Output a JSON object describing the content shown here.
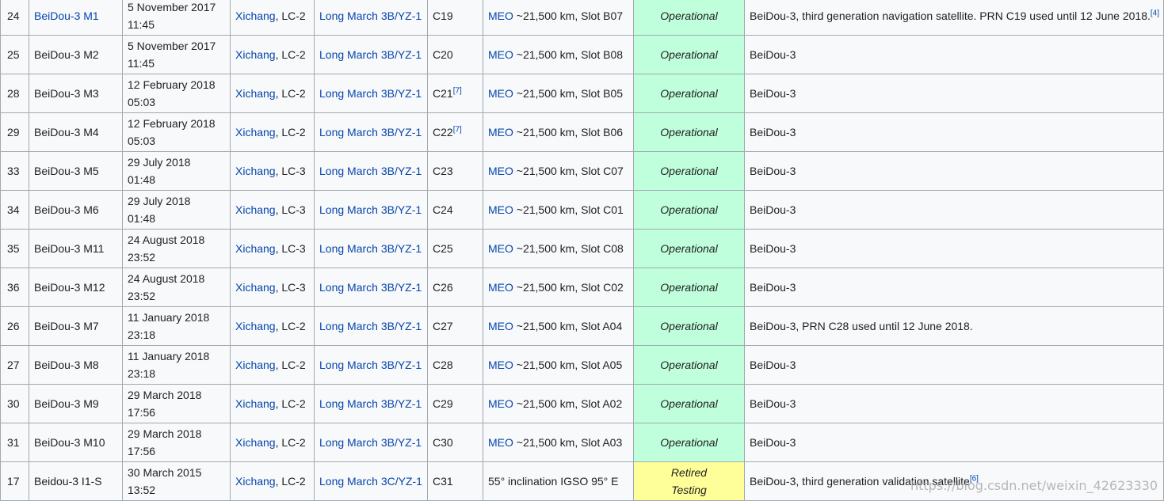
{
  "rows": [
    {
      "n": "24",
      "name": "BeiDou-3 M1",
      "name_link": true,
      "date1": "5 November 2017",
      "date2": "11:45",
      "site_link": "Xichang",
      "site_rest": ", LC-2",
      "rocket": "Long March 3B/YZ-1",
      "prn": "C19",
      "prn_sup": "",
      "orbit_link": "MEO",
      "orbit_rest": " ~21,500 km, Slot B07",
      "status": "Operational",
      "status_type": "op",
      "status2": "",
      "remarks": "BeiDou-3, third generation navigation satellite. PRN C19 used until 12 June 2018.",
      "remarks_sup": "[4]"
    },
    {
      "n": "25",
      "name": "BeiDou-3 M2",
      "name_link": false,
      "date1": "5 November 2017",
      "date2": "11:45",
      "site_link": "Xichang",
      "site_rest": ", LC-2",
      "rocket": "Long March 3B/YZ-1",
      "prn": "C20",
      "prn_sup": "",
      "orbit_link": "MEO",
      "orbit_rest": " ~21,500 km, Slot B08",
      "status": "Operational",
      "status_type": "op",
      "status2": "",
      "remarks": "BeiDou-3",
      "remarks_sup": ""
    },
    {
      "n": "28",
      "name": "BeiDou-3 M3",
      "name_link": false,
      "date1": "12 February 2018",
      "date2": "05:03",
      "site_link": "Xichang",
      "site_rest": ", LC-2",
      "rocket": "Long March 3B/YZ-1",
      "prn": "C21",
      "prn_sup": "[7]",
      "orbit_link": "MEO",
      "orbit_rest": " ~21,500 km, Slot B05",
      "status": "Operational",
      "status_type": "op",
      "status2": "",
      "remarks": "BeiDou-3",
      "remarks_sup": ""
    },
    {
      "n": "29",
      "name": "BeiDou-3 M4",
      "name_link": false,
      "date1": "12 February 2018",
      "date2": "05:03",
      "site_link": "Xichang",
      "site_rest": ", LC-2",
      "rocket": "Long March 3B/YZ-1",
      "prn": "C22",
      "prn_sup": "[7]",
      "orbit_link": "MEO",
      "orbit_rest": " ~21,500 km, Slot B06",
      "status": "Operational",
      "status_type": "op",
      "status2": "",
      "remarks": "BeiDou-3",
      "remarks_sup": ""
    },
    {
      "n": "33",
      "name": "BeiDou-3 M5",
      "name_link": false,
      "date1": "29 July 2018",
      "date2": "01:48",
      "site_link": "Xichang",
      "site_rest": ", LC-3",
      "rocket": "Long March 3B/YZ-1",
      "prn": "C23",
      "prn_sup": "",
      "orbit_link": "MEO",
      "orbit_rest": " ~21,500 km, Slot C07",
      "status": "Operational",
      "status_type": "op",
      "status2": "",
      "remarks": "BeiDou-3",
      "remarks_sup": ""
    },
    {
      "n": "34",
      "name": "BeiDou-3 M6",
      "name_link": false,
      "date1": "29 July 2018",
      "date2": "01:48",
      "site_link": "Xichang",
      "site_rest": ", LC-3",
      "rocket": "Long March 3B/YZ-1",
      "prn": "C24",
      "prn_sup": "",
      "orbit_link": "MEO",
      "orbit_rest": " ~21,500 km, Slot C01",
      "status": "Operational",
      "status_type": "op",
      "status2": "",
      "remarks": "BeiDou-3",
      "remarks_sup": ""
    },
    {
      "n": "35",
      "name": "BeiDou-3 M11",
      "name_link": false,
      "date1": "24 August 2018",
      "date2": "23:52",
      "site_link": "Xichang",
      "site_rest": ", LC-3",
      "rocket": "Long March 3B/YZ-1",
      "prn": "C25",
      "prn_sup": "",
      "orbit_link": "MEO",
      "orbit_rest": " ~21,500 km, Slot C08",
      "status": "Operational",
      "status_type": "op",
      "status2": "",
      "remarks": "BeiDou-3",
      "remarks_sup": ""
    },
    {
      "n": "36",
      "name": "BeiDou-3 M12",
      "name_link": false,
      "date1": "24 August 2018",
      "date2": "23:52",
      "site_link": "Xichang",
      "site_rest": ", LC-3",
      "rocket": "Long March 3B/YZ-1",
      "prn": "C26",
      "prn_sup": "",
      "orbit_link": "MEO",
      "orbit_rest": " ~21,500 km, Slot C02",
      "status": "Operational",
      "status_type": "op",
      "status2": "",
      "remarks": "BeiDou-3",
      "remarks_sup": ""
    },
    {
      "n": "26",
      "name": "BeiDou-3 M7",
      "name_link": false,
      "date1": "11 January 2018",
      "date2": "23:18",
      "site_link": "Xichang",
      "site_rest": ", LC-2",
      "rocket": "Long March 3B/YZ-1",
      "prn": "C27",
      "prn_sup": "",
      "orbit_link": "MEO",
      "orbit_rest": " ~21,500 km, Slot A04",
      "status": "Operational",
      "status_type": "op",
      "status2": "",
      "remarks": "BeiDou-3, PRN C28 used until 12 June 2018.",
      "remarks_sup": ""
    },
    {
      "n": "27",
      "name": "BeiDou-3 M8",
      "name_link": false,
      "date1": "11 January 2018",
      "date2": "23:18",
      "site_link": "Xichang",
      "site_rest": ", LC-2",
      "rocket": "Long March 3B/YZ-1",
      "prn": "C28",
      "prn_sup": "",
      "orbit_link": "MEO",
      "orbit_rest": " ~21,500 km, Slot A05",
      "status": "Operational",
      "status_type": "op",
      "status2": "",
      "remarks": "BeiDou-3",
      "remarks_sup": ""
    },
    {
      "n": "30",
      "name": "BeiDou-3 M9",
      "name_link": false,
      "date1": "29 March 2018",
      "date2": "17:56",
      "site_link": "Xichang",
      "site_rest": ", LC-2",
      "rocket": "Long March 3B/YZ-1",
      "prn": "C29",
      "prn_sup": "",
      "orbit_link": "MEO",
      "orbit_rest": " ~21,500 km, Slot A02",
      "status": "Operational",
      "status_type": "op",
      "status2": "",
      "remarks": "BeiDou-3",
      "remarks_sup": ""
    },
    {
      "n": "31",
      "name": "BeiDou-3 M10",
      "name_link": false,
      "date1": "29 March 2018",
      "date2": "17:56",
      "site_link": "Xichang",
      "site_rest": ", LC-2",
      "rocket": "Long March 3B/YZ-1",
      "prn": "C30",
      "prn_sup": "",
      "orbit_link": "MEO",
      "orbit_rest": " ~21,500 km, Slot A03",
      "status": "Operational",
      "status_type": "op",
      "status2": "",
      "remarks": "BeiDou-3",
      "remarks_sup": ""
    },
    {
      "n": "17",
      "name": "Beidou-3 I1-S",
      "name_link": false,
      "date1": "30 March 2015",
      "date2": "13:52",
      "site_link": "Xichang",
      "site_rest": ", LC-2",
      "rocket": "Long March 3C/YZ-1",
      "prn": "C31",
      "prn_sup": "",
      "orbit_link": "",
      "orbit_rest": "55° inclination IGSO 95° E",
      "status": "Retired",
      "status_type": "ret",
      "status2": "Testing",
      "remarks": "BeiDou-3, third generation validation satellite",
      "remarks_sup": "[6]"
    }
  ],
  "watermark": "https://blog.csdn.net/weixin_42623330",
  "colors": {
    "link": "#0645ad",
    "operational_bg": "#bfffdb",
    "retired_bg": "#ffff99",
    "cell_bg": "#f8f9fa",
    "border": "#a2a9b1"
  }
}
